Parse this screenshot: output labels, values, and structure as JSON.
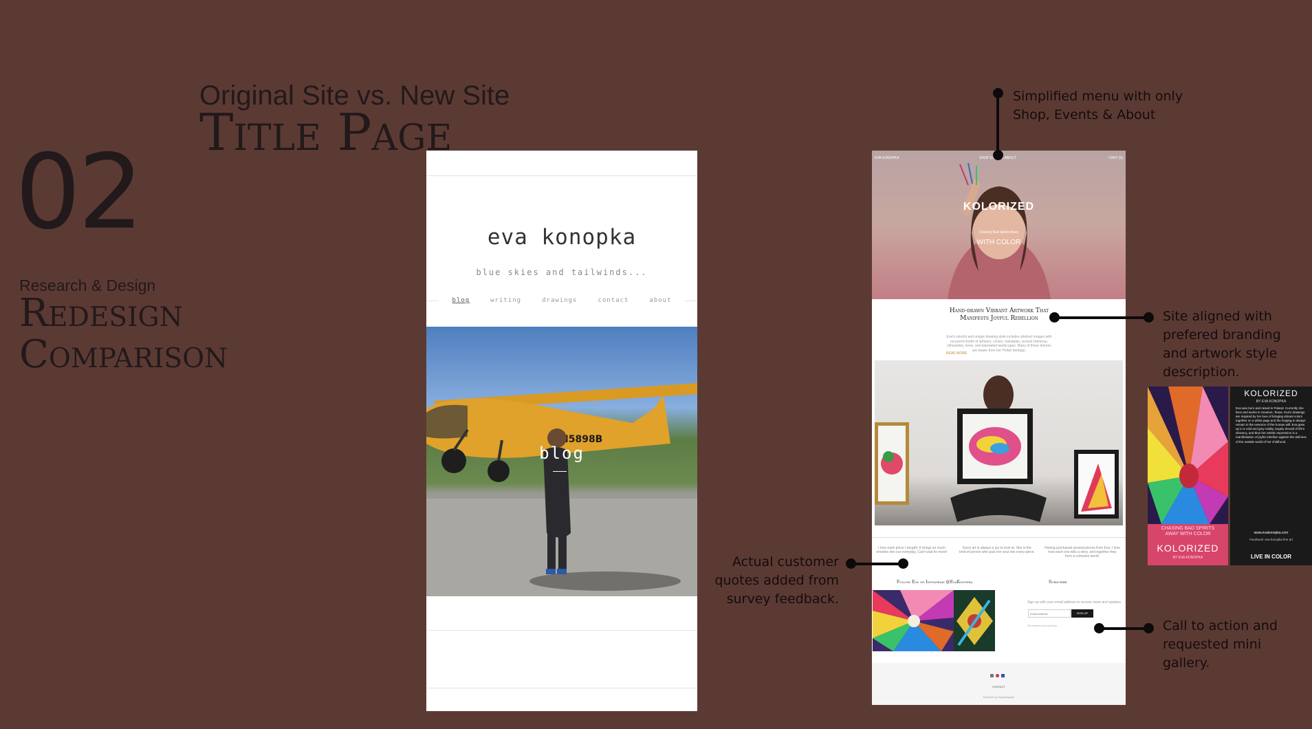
{
  "slide": {
    "number": "02",
    "subtitle": "Original Site vs. New Site",
    "title": "Title Page",
    "section_label": "Research & Design",
    "section_title_1": "Redesign",
    "section_title_2": "Comparison"
  },
  "old_site": {
    "name": "eva konopka",
    "tagline": "blue skies and tailwinds...",
    "nav": [
      "blog",
      "writing",
      "drawings",
      "contact",
      "about"
    ],
    "photo_label": "blog",
    "plane_tail": "N5898B"
  },
  "new_site": {
    "brand": "EVA KONOPKA",
    "nav": "SHOP  EVENTS  ABOUT",
    "top_right": "CART (0)",
    "hero_title": "KOLORIZED",
    "hero_line1": "Chasing Bad Spirits Away",
    "hero_line2": "WITH COLOR",
    "headline": "Hand-drawn Vibrant Artwork That Manifests Joyful Rebellion",
    "body_text": "Eva's colorful and unique drawing style includes abstract images with recurrent motifs of spheres, circles, mandalas, surreal chimeras, silhouettes, trees, and bejeweled landscapes. Many of these themes are drawn from her Polish heritage.",
    "link": "READ MORE",
    "quotes": [
      "I love each piece I bought. It brings so much emotion into our everyday. Can't wait for more!",
      "Eva's art is always a joy to look at. She is the kind of person who puts her soul into every piece.",
      "Having purchased several pieces from Eva, I love how each one tells a story, and together they form a cohesive world."
    ],
    "instagram_heading": "Follow Eva on Instagram @EvaKonopka",
    "subscribe_heading": "Subscribe",
    "subscribe_text": "Sign up with your email address to receive news and updates.",
    "email_placeholder": "Email Address",
    "signup_label": "SIGN UP",
    "privacy_text": "We respect your privacy.",
    "footer_contact": "CONTACT",
    "footer_powered": "Powered by Squarespace"
  },
  "annotations": {
    "menu": "Simplified menu with only Shop, Events & About",
    "branding": "Site aligned with prefered branding and artwork style description.",
    "quotes": "Actual customer quotes added from survey feedback.",
    "cta": "Call to action and requested mini gallery."
  },
  "book": {
    "title": "KOLORIZED",
    "byline": "BY EVA KONOPKA",
    "cover_tagline": "CHASING BAD SPIRITS AWAY WITH COLOR",
    "cover_title": "KOLORIZED",
    "cover_byline": "BY EVA KONOPKA",
    "back_text": "Eva was born and raised in Poland. Currently she lives and works in Houston, Texas. Eva's drawings are inspired by her love of bringing vibrant colors together on a white page and the longing to always remain in the essence of the human will. Eva grew up in a cold and grey reality, largely devoid of life's vibrancy, and thus her artistic expression is a manifestation of joyful rebellion against the dullness of the outside world of her childhood.",
    "website": "www.evakonopka.com",
    "social": "Facebook: eva konopka fine art",
    "live": "LIVE IN COLOR"
  },
  "colors": {
    "background": "#5c3a34",
    "ink": "#22191a"
  }
}
